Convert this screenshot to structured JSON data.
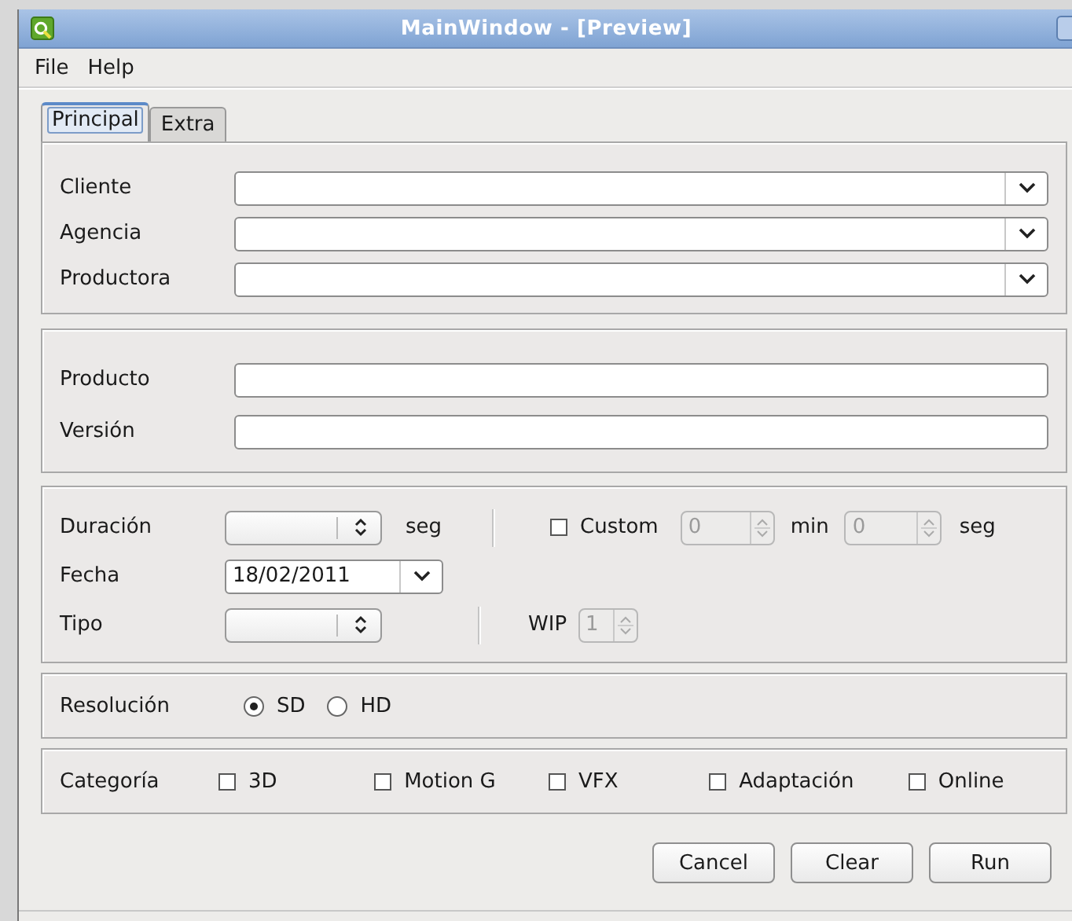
{
  "window": {
    "title": "MainWindow - [Preview]"
  },
  "menu": [
    {
      "label": "File"
    },
    {
      "label": "Help"
    }
  ],
  "tabs": [
    {
      "label": "Principal",
      "selected": true
    },
    {
      "label": "Extra",
      "selected": false
    }
  ],
  "combos": [
    {
      "label": "Cliente"
    },
    {
      "label": "Agencia"
    },
    {
      "label": "Productora"
    }
  ],
  "text_fields": [
    {
      "label": "Producto"
    },
    {
      "label": "Versión"
    }
  ],
  "duration": {
    "label": "Duración",
    "unit": "seg"
  },
  "custom": {
    "label": "Custom",
    "checked": false,
    "disabled": true,
    "minutes": "0",
    "minutes_unit": "min",
    "seconds": "0",
    "seconds_unit": "seg"
  },
  "date": {
    "label": "Fecha",
    "value": "18/02/2011"
  },
  "tipo": {
    "label": "Tipo"
  },
  "wip": {
    "label": "WIP",
    "value": "1",
    "disabled": true
  },
  "resolution": {
    "label": "Resolución",
    "options": [
      {
        "label": "SD",
        "selected": true
      },
      {
        "label": "HD",
        "selected": false
      }
    ]
  },
  "category": {
    "label": "Categoría",
    "options": [
      {
        "label": "3D",
        "checked": false
      },
      {
        "label": "Motion G",
        "checked": false
      },
      {
        "label": "VFX",
        "checked": false
      },
      {
        "label": "Adaptación",
        "checked": false
      },
      {
        "label": "Online",
        "checked": false
      }
    ]
  },
  "buttons": [
    {
      "label": "Cancel"
    },
    {
      "label": "Clear"
    },
    {
      "label": "Run"
    }
  ]
}
